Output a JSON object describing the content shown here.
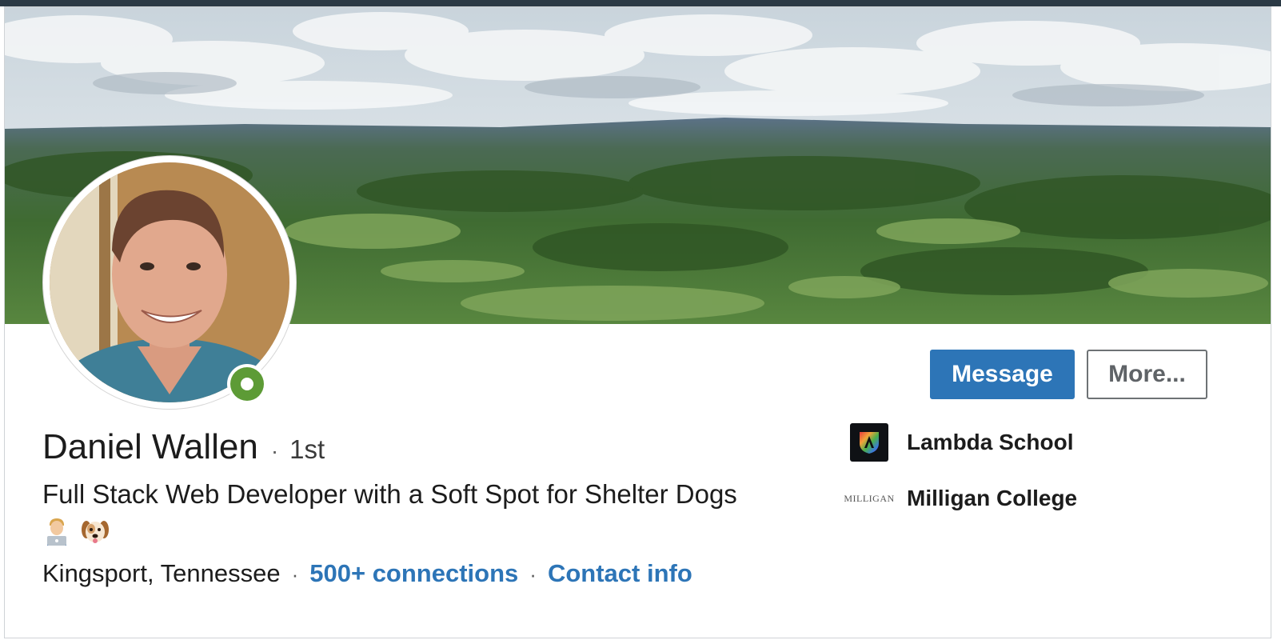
{
  "profile": {
    "name": "Daniel Wallen",
    "degree_separator": "·",
    "degree": "1st",
    "headline": "Full Stack Web Developer with a Soft Spot for Shelter Dogs",
    "headline_emojis": [
      "technologist-emoji",
      "dog-face-emoji"
    ],
    "location": "Kingsport, Tennessee",
    "connections": "500+ connections",
    "contact_info": "Contact info",
    "separator": "·",
    "presence_status": "online"
  },
  "actions": {
    "message_label": "Message",
    "more_label": "More..."
  },
  "organizations": [
    {
      "name": "Lambda School",
      "logo_icon": "lambda-school-logo"
    },
    {
      "name": "Milligan College",
      "logo_icon": "milligan-college-logo",
      "logo_text": "MILLIGAN"
    }
  ],
  "colors": {
    "accent": "#2d75b7",
    "presence_online": "#5d9b36",
    "text": "#1c1c1c"
  }
}
